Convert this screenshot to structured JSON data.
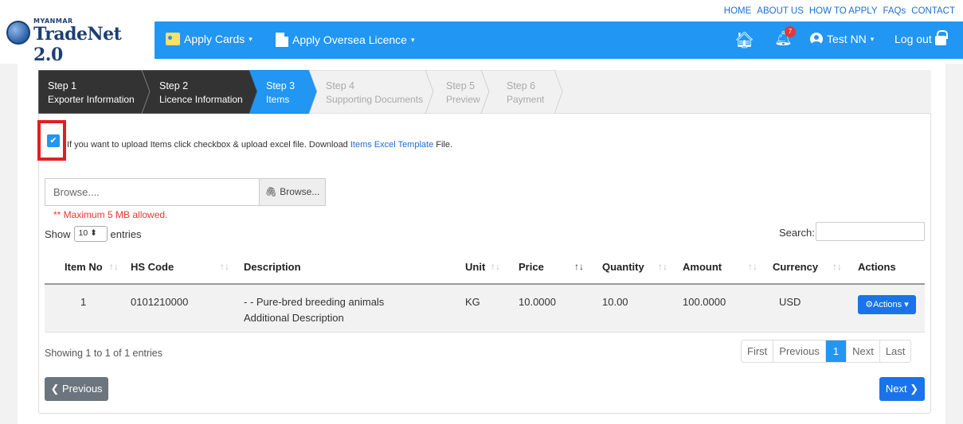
{
  "logo": {
    "small": "MYANMAR",
    "big": "TradeNet 2.0"
  },
  "toplinks": [
    "HOME",
    "ABOUT US",
    "HOW TO APPLY",
    "FAQs",
    "CONTACT"
  ],
  "nav": {
    "apply_cards": "Apply Cards",
    "apply_oversea": "Apply Oversea Licence",
    "notification_count": "7",
    "user": "Test NN",
    "logout": "Log out",
    "caret": "▾"
  },
  "steps": [
    {
      "num": "Step 1",
      "label": "Exporter Information",
      "state": "done"
    },
    {
      "num": "Step 2",
      "label": "Licence Information",
      "state": "done"
    },
    {
      "num": "Step 3",
      "label": "Items",
      "state": "active"
    },
    {
      "num": "Step 4",
      "label": "Supporting Documents",
      "state": "pending"
    },
    {
      "num": "Step 5",
      "label": "Preview",
      "state": "pending"
    },
    {
      "num": "Step 6",
      "label": "Payment",
      "state": "pending"
    }
  ],
  "upload": {
    "text_pre": "If you want to upload Items click checkbox & upload excel file. Download ",
    "link": "Items Excel Template",
    "text_post": " File.",
    "file_placeholder": "Browse....",
    "browse_label": "Browse...",
    "max_note": "** Maximum 5 MB allowed."
  },
  "table": {
    "show_label": "Show",
    "entries_value": "10",
    "entries_label": "entries",
    "search_label": "Search:",
    "headers": [
      "Item No",
      "HS Code",
      "Description",
      "Unit",
      "Price",
      "Quantity",
      "Amount",
      "Currency",
      "Actions"
    ],
    "rows": [
      {
        "item_no": "1",
        "hs_code": "0101210000",
        "description": "- - Pure-bred breeding animals",
        "description2": "Additional Description",
        "unit": "KG",
        "price": "10.0000",
        "quantity": "10.00",
        "amount": "100.0000",
        "currency": "USD",
        "action_label": "Actions"
      }
    ],
    "showing": "Showing 1 to 1 of 1 entries"
  },
  "pager": {
    "first": "First",
    "previous": "Previous",
    "current": "1",
    "next": "Next",
    "last": "Last"
  },
  "buttons": {
    "previous": "Previous",
    "next": "Next"
  },
  "colors": {
    "nav": "#2196f3",
    "step_done": "#333333",
    "step_active": "#2196f3",
    "highlight": "#e02020"
  }
}
